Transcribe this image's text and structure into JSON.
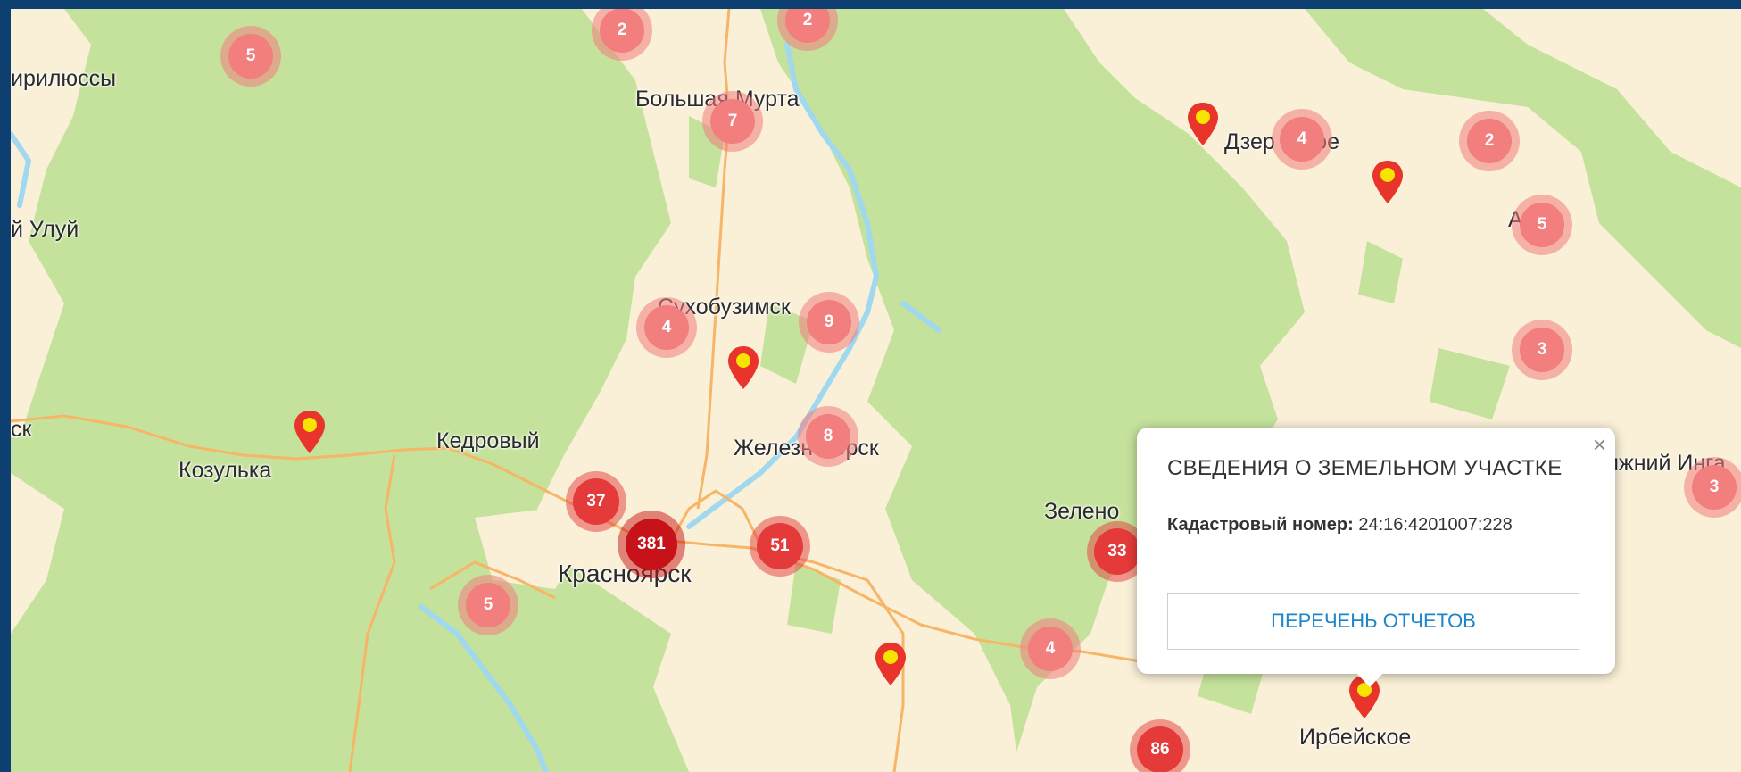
{
  "map": {
    "colors": {
      "forest": "#c4e29c",
      "open_land": "#faf0d8",
      "river": "#9fd8ef",
      "road": "#f7b567"
    },
    "places": {
      "birilyussy": "ирилюссы",
      "bolshaya_murta": "Большая Мурта",
      "dzerzhinskoe": "Дзер   нское",
      "ului": "й Улуй",
      "sukhobuzimskoe": "Сухобузимск",
      "kedrovy": "Кедровый",
      "kozulka": "Козулька",
      "zheleznogorsk": "Железногорск",
      "zelenogorsk": "Зелено",
      "krasnoyarsk": "Красноярск",
      "irbeyskoe": "Ирбейское",
      "nizhny_ingash": "ижний Инга",
      "ck": "ск",
      "a_fragment": "А"
    },
    "clusters": [
      "5",
      "2",
      "2",
      "7",
      "4",
      "2",
      "5",
      "4",
      "9",
      "3",
      "8",
      "37",
      "381",
      "51",
      "5",
      "33",
      "4",
      "86",
      "3"
    ],
    "marker_icon": "map-pin-icon"
  },
  "popup": {
    "close_label": "×",
    "title": "СВЕДЕНИЯ О ЗЕМЕЛЬНОМ УЧАСТКЕ",
    "cadastral_label": "Кадастровый номер:",
    "cadastral_value": "24:16:4201007:228",
    "button_label": "ПЕРЕЧЕНЬ ОТЧЕТОВ"
  }
}
